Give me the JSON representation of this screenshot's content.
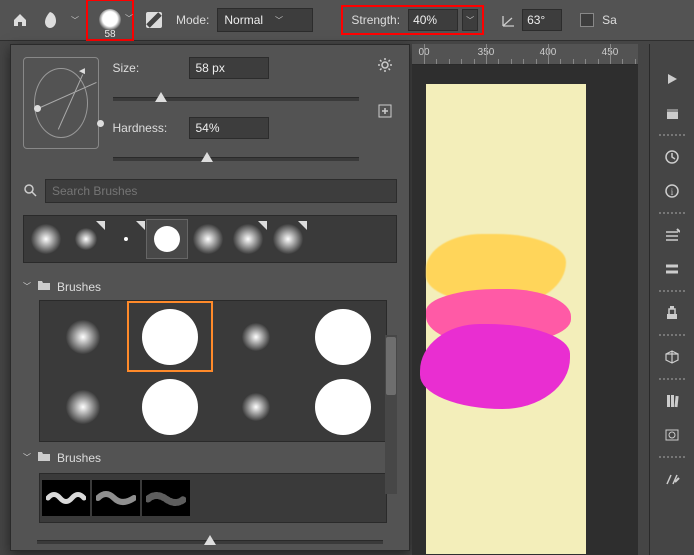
{
  "toolbar": {
    "brush_preset_size": "58",
    "mode_label": "Mode:",
    "mode_value": "Normal",
    "strength_label": "Strength:",
    "strength_value": "40%",
    "angle_value": "63°",
    "sample_label": "Sa"
  },
  "panel": {
    "size_label": "Size:",
    "size_value": "58 px",
    "hardness_label": "Hardness:",
    "hardness_value": "54%",
    "search_placeholder": "Search Brushes",
    "folder1_label": "Brushes",
    "folder2_label": "Brushes"
  },
  "ruler": {
    "ticks": [
      "00",
      "350",
      "400",
      "450"
    ]
  }
}
